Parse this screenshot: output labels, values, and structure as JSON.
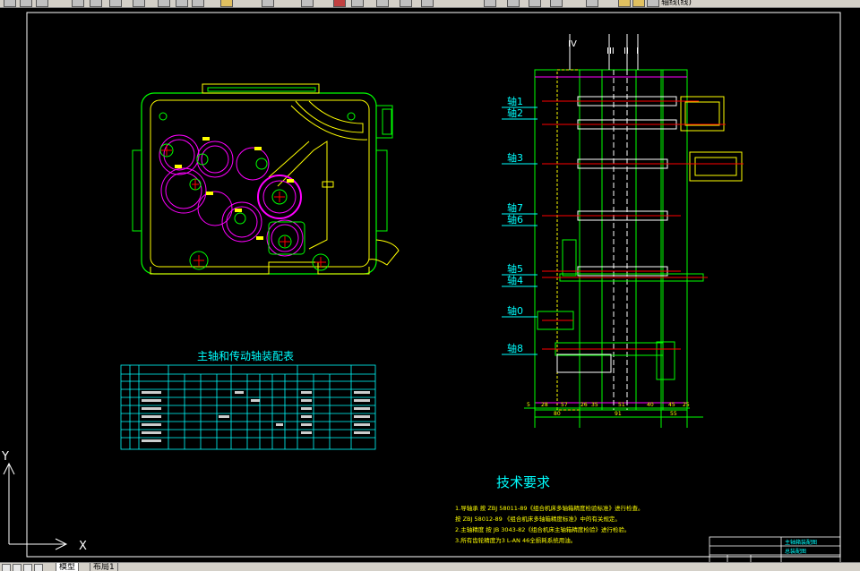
{
  "toolbar": {
    "layer_name": "轴线(线)"
  },
  "drawing": {
    "shaft_labels": [
      "轴1",
      "轴2",
      "轴3",
      "轴7",
      "轴6",
      "轴5",
      "轴4",
      "轴0",
      "轴8"
    ],
    "roman_marks": [
      "IV",
      "III",
      "II",
      "I"
    ],
    "table_title": "主轴和传动轴装配表",
    "dims_top": [
      "5",
      "28",
      "57",
      "26",
      "35",
      "51",
      "40",
      "45",
      "25"
    ],
    "dims_bottom": [
      "80",
      "91",
      "55"
    ],
    "tech_title": "技术要求",
    "tech_lines": [
      "1.导轴承 按 ZBJ 58011-89《组合机床多轴箱精度检验标准》进行检查。",
      "       按 ZBJ 58012-89 《组合机床多轴箱精度标准》中的有关规定。",
      "2.主轴精度 按 JB 3043-82《组合机床主轴箱精度检验》进行检验。",
      "3.所有齿轮精度为3 L-AN 46全损耗系统用油。"
    ],
    "title_block": [
      "主轴箱装配图",
      "总装配图"
    ]
  },
  "axis_labels": {
    "x": "X",
    "y": "Y"
  },
  "tabs": {
    "model": "模型",
    "layout": "布局1"
  }
}
